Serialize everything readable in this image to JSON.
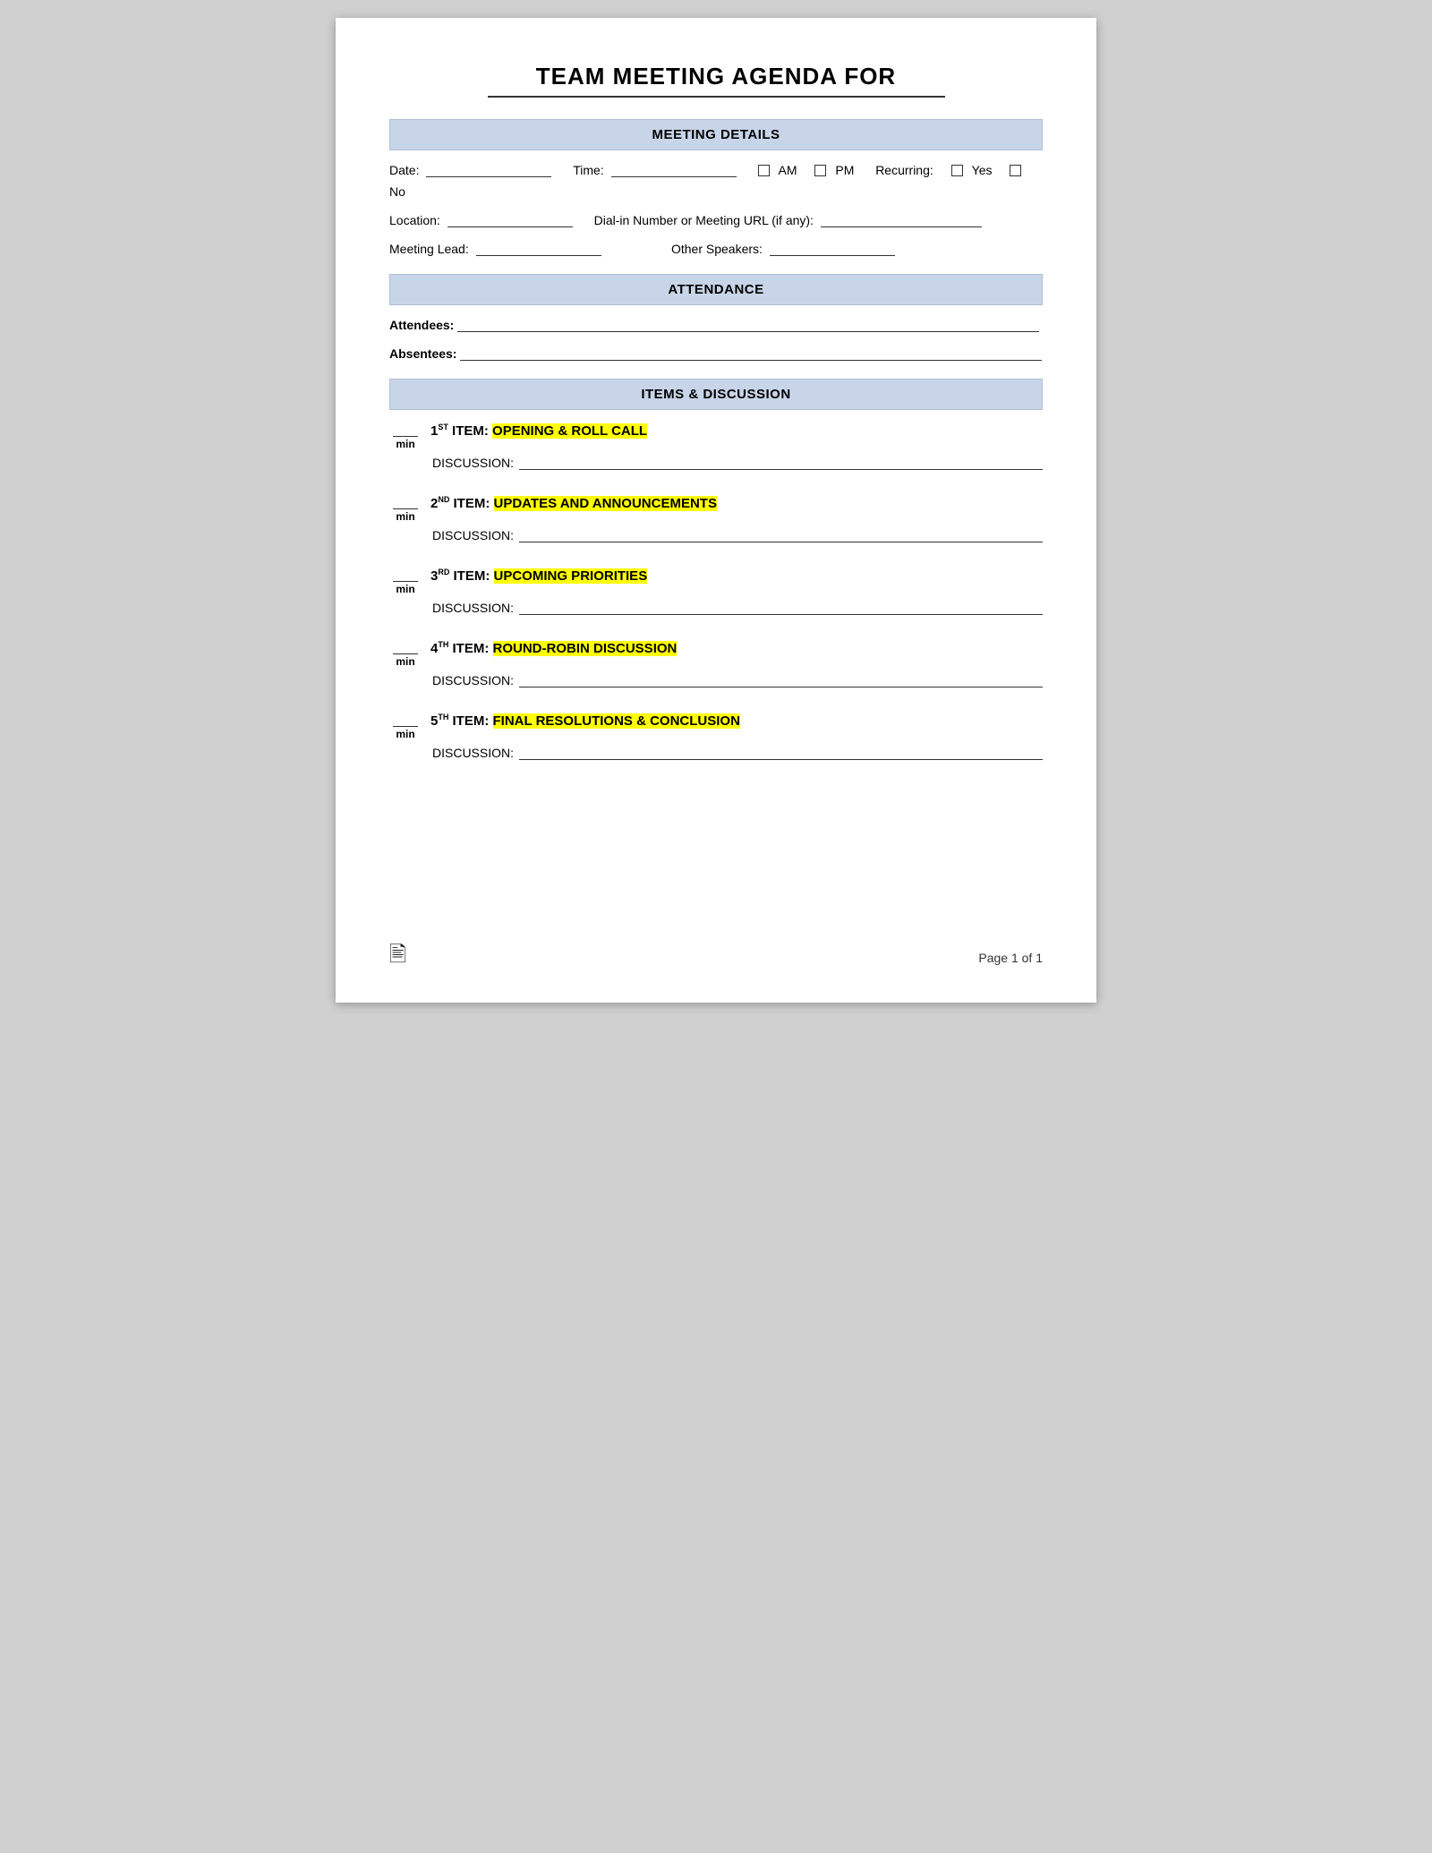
{
  "title": {
    "main": "TEAM MEETING AGENDA FOR"
  },
  "sections": {
    "meeting_details": "MEETING DETAILS",
    "attendance": "ATTENDANCE",
    "items_discussion": "ITEMS & DISCUSSION"
  },
  "meeting_fields": {
    "date_label": "Date:",
    "time_label": "Time:",
    "am_label": "AM",
    "pm_label": "PM",
    "recurring_label": "Recurring:",
    "yes_label": "Yes",
    "no_label": "No",
    "location_label": "Location:",
    "dialin_label": "Dial-in Number or Meeting URL (if any):",
    "meeting_lead_label": "Meeting Lead:",
    "other_speakers_label": "Other Speakers:"
  },
  "attendance_fields": {
    "attendees_label": "Attendees:",
    "absentees_label": "Absentees:"
  },
  "agenda_items": [
    {
      "number": "1",
      "ordinal": "ST",
      "title": "ITEM:",
      "highlight_text": "OPENING & ROLL CALL",
      "discussion_label": "DISCUSSION:"
    },
    {
      "number": "2",
      "ordinal": "ND",
      "title": "ITEM:",
      "highlight_text": "UPDATES AND ANNOUNCEMENTS",
      "discussion_label": "DISCUSSION:"
    },
    {
      "number": "3",
      "ordinal": "RD",
      "title": "ITEM:",
      "highlight_text": "UPCOMING PRIORITIES",
      "discussion_label": "DISCUSSION:"
    },
    {
      "number": "4",
      "ordinal": "TH",
      "title": "ITEM:",
      "highlight_text": "ROUND-ROBIN DISCUSSION",
      "discussion_label": "DISCUSSION:"
    },
    {
      "number": "5",
      "ordinal": "TH",
      "title": "ITEM:",
      "highlight_text": "FINAL RESOLUTIONS & CONCLUSION",
      "discussion_label": "DISCUSSION:"
    }
  ],
  "footer": {
    "page_text": "Page 1 of 1",
    "icon": "🖹"
  }
}
